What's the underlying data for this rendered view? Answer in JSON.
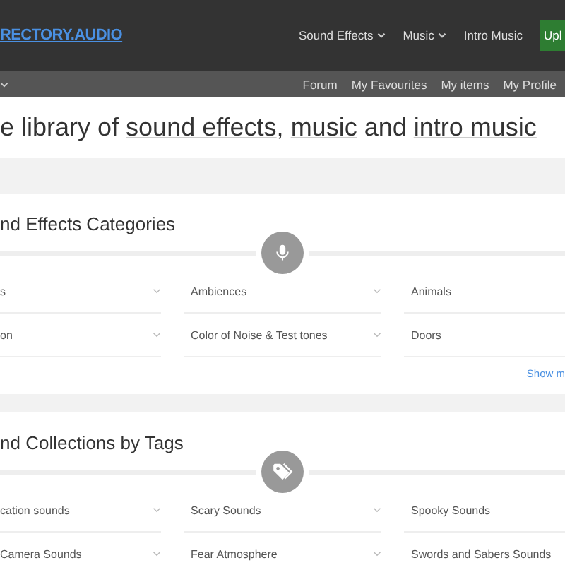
{
  "header": {
    "logo": "RECTORY.AUDIO",
    "nav": [
      {
        "label": "Sound Effects",
        "dropdown": true
      },
      {
        "label": "Music",
        "dropdown": true
      },
      {
        "label": "Intro Music",
        "dropdown": false
      }
    ],
    "upload_button": "Upl"
  },
  "subnav": {
    "links": [
      "Forum",
      "My Favourites",
      "My items",
      "My Profile"
    ]
  },
  "headline": [
    {
      "before": "e library of ",
      "link": "sound effects"
    },
    {
      "before": ", ",
      "link": "music"
    },
    {
      "before": " and ",
      "link": "intro music"
    }
  ],
  "sections": [
    {
      "title": "nd Effects Categories",
      "items": [
        {
          "label": "s"
        },
        {
          "label": "Ambiences"
        },
        {
          "label": "Animals"
        },
        {
          "label": "on"
        },
        {
          "label": "Color of Noise & Test tones"
        },
        {
          "label": "Doors"
        }
      ],
      "show_more": "Show m"
    },
    {
      "title": "nd Collections by Tags",
      "items": [
        {
          "label": "cation sounds"
        },
        {
          "label": "Scary Sounds"
        },
        {
          "label": "Spooky Sounds"
        },
        {
          "label": "Camera Sounds"
        },
        {
          "label": "Fear Atmosphere"
        },
        {
          "label": "Swords and Sabers Sounds"
        }
      ]
    }
  ]
}
